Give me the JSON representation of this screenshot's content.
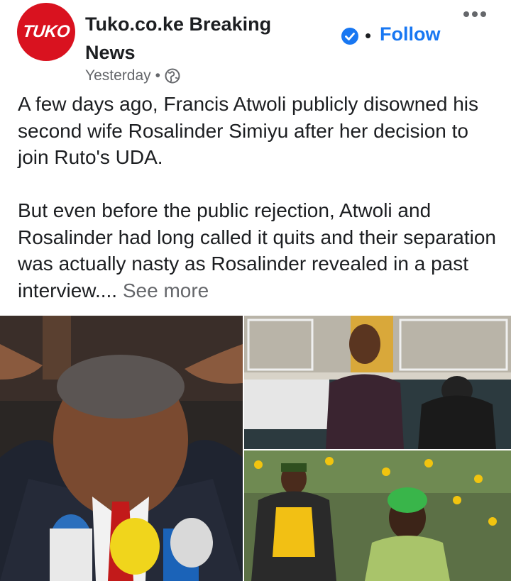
{
  "page": {
    "avatar_text": "TUKO",
    "name": "Tuko.co.ke Breaking News",
    "timestamp": "Yesterday",
    "separator": "•",
    "follow_label": "Follow",
    "verified_icon": "verified-badge-icon",
    "audience_icon": "globe-icon",
    "more_icon": "more-options-icon"
  },
  "post": {
    "paragraph_1": "A few days ago, Francis Atwoli publicly disowned his second wife Rosalinder Simiyu after her decision to join Ruto's UDA.",
    "paragraph_2": "But even before the public rejection, Atwoli and Rosalinder had long called it quits and their separation was actually nasty as Rosalinder revealed in a past interview....",
    "see_more": " See more"
  },
  "colors": {
    "brand_red": "#d9121f",
    "link_blue": "#1877f2",
    "secondary_text": "#65676b"
  }
}
